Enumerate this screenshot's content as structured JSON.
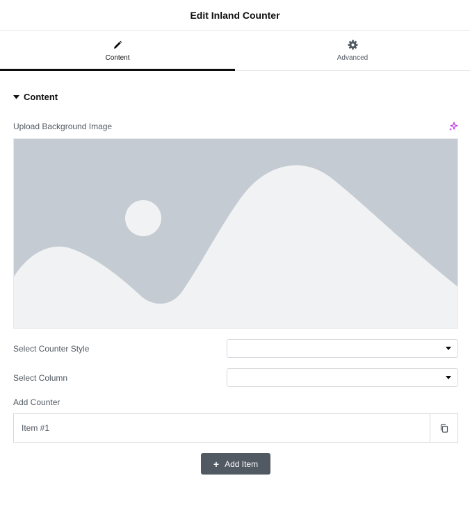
{
  "header": {
    "title": "Edit Inland Counter"
  },
  "tabs": [
    {
      "label": "Content",
      "icon": "pencil-icon",
      "active": true
    },
    {
      "label": "Advanced",
      "icon": "gear-icon",
      "active": false
    }
  ],
  "section": {
    "title": "Content"
  },
  "fields": {
    "upload_label": "Upload Background Image",
    "counter_style_label": "Select Counter Style",
    "counter_style_value": "",
    "column_label": "Select Column",
    "column_value": "",
    "add_counter_label": "Add Counter"
  },
  "repeater": {
    "items": [
      {
        "title": "Item #1"
      }
    ]
  },
  "add_button": {
    "label": "Add Item"
  },
  "colors": {
    "accent": "#0c0d0e",
    "ai_sparkle": "#c036e8",
    "placeholder_bg": "#c4cbd2",
    "placeholder_fg": "#f1f2f3",
    "button_bg": "#515962"
  }
}
